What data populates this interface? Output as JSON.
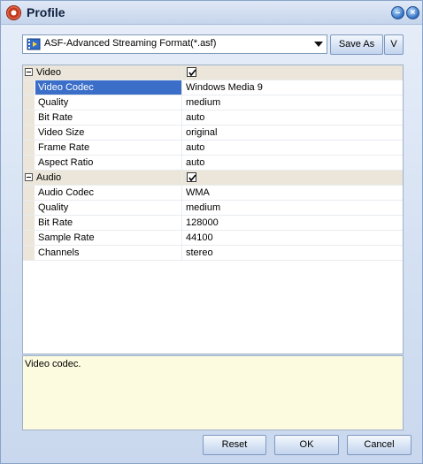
{
  "window": {
    "title": "Profile"
  },
  "profile": {
    "format": "ASF-Advanced Streaming Format(*.asf)",
    "save_as_label": "Save As",
    "v_label": "V"
  },
  "properties": {
    "video": {
      "label": "Video",
      "enabled": true,
      "rows": [
        {
          "name": "Video Codec",
          "value": "Windows Media 9"
        },
        {
          "name": "Quality",
          "value": "medium"
        },
        {
          "name": "Bit Rate",
          "value": "auto"
        },
        {
          "name": "Video Size",
          "value": "original"
        },
        {
          "name": "Frame Rate",
          "value": "auto"
        },
        {
          "name": "Aspect Ratio",
          "value": "auto"
        }
      ]
    },
    "audio": {
      "label": "Audio",
      "enabled": true,
      "rows": [
        {
          "name": "Audio Codec",
          "value": "WMA"
        },
        {
          "name": "Quality",
          "value": "medium"
        },
        {
          "name": "Bit Rate",
          "value": "128000"
        },
        {
          "name": "Sample Rate",
          "value": "44100"
        },
        {
          "name": "Channels",
          "value": "stereo"
        }
      ]
    }
  },
  "description": "Video codec.",
  "buttons": {
    "reset": "Reset",
    "ok": "OK",
    "cancel": "Cancel"
  },
  "icons": {
    "app": "app-logo-icon",
    "minimize": "minimize-icon",
    "close": "close-icon",
    "format": "film-icon",
    "dropdown": "chevron-down-icon"
  },
  "colors": {
    "selection": "#3a6ec8",
    "description_bg": "#fcfbdf",
    "group_bg": "#ebe6d9"
  }
}
